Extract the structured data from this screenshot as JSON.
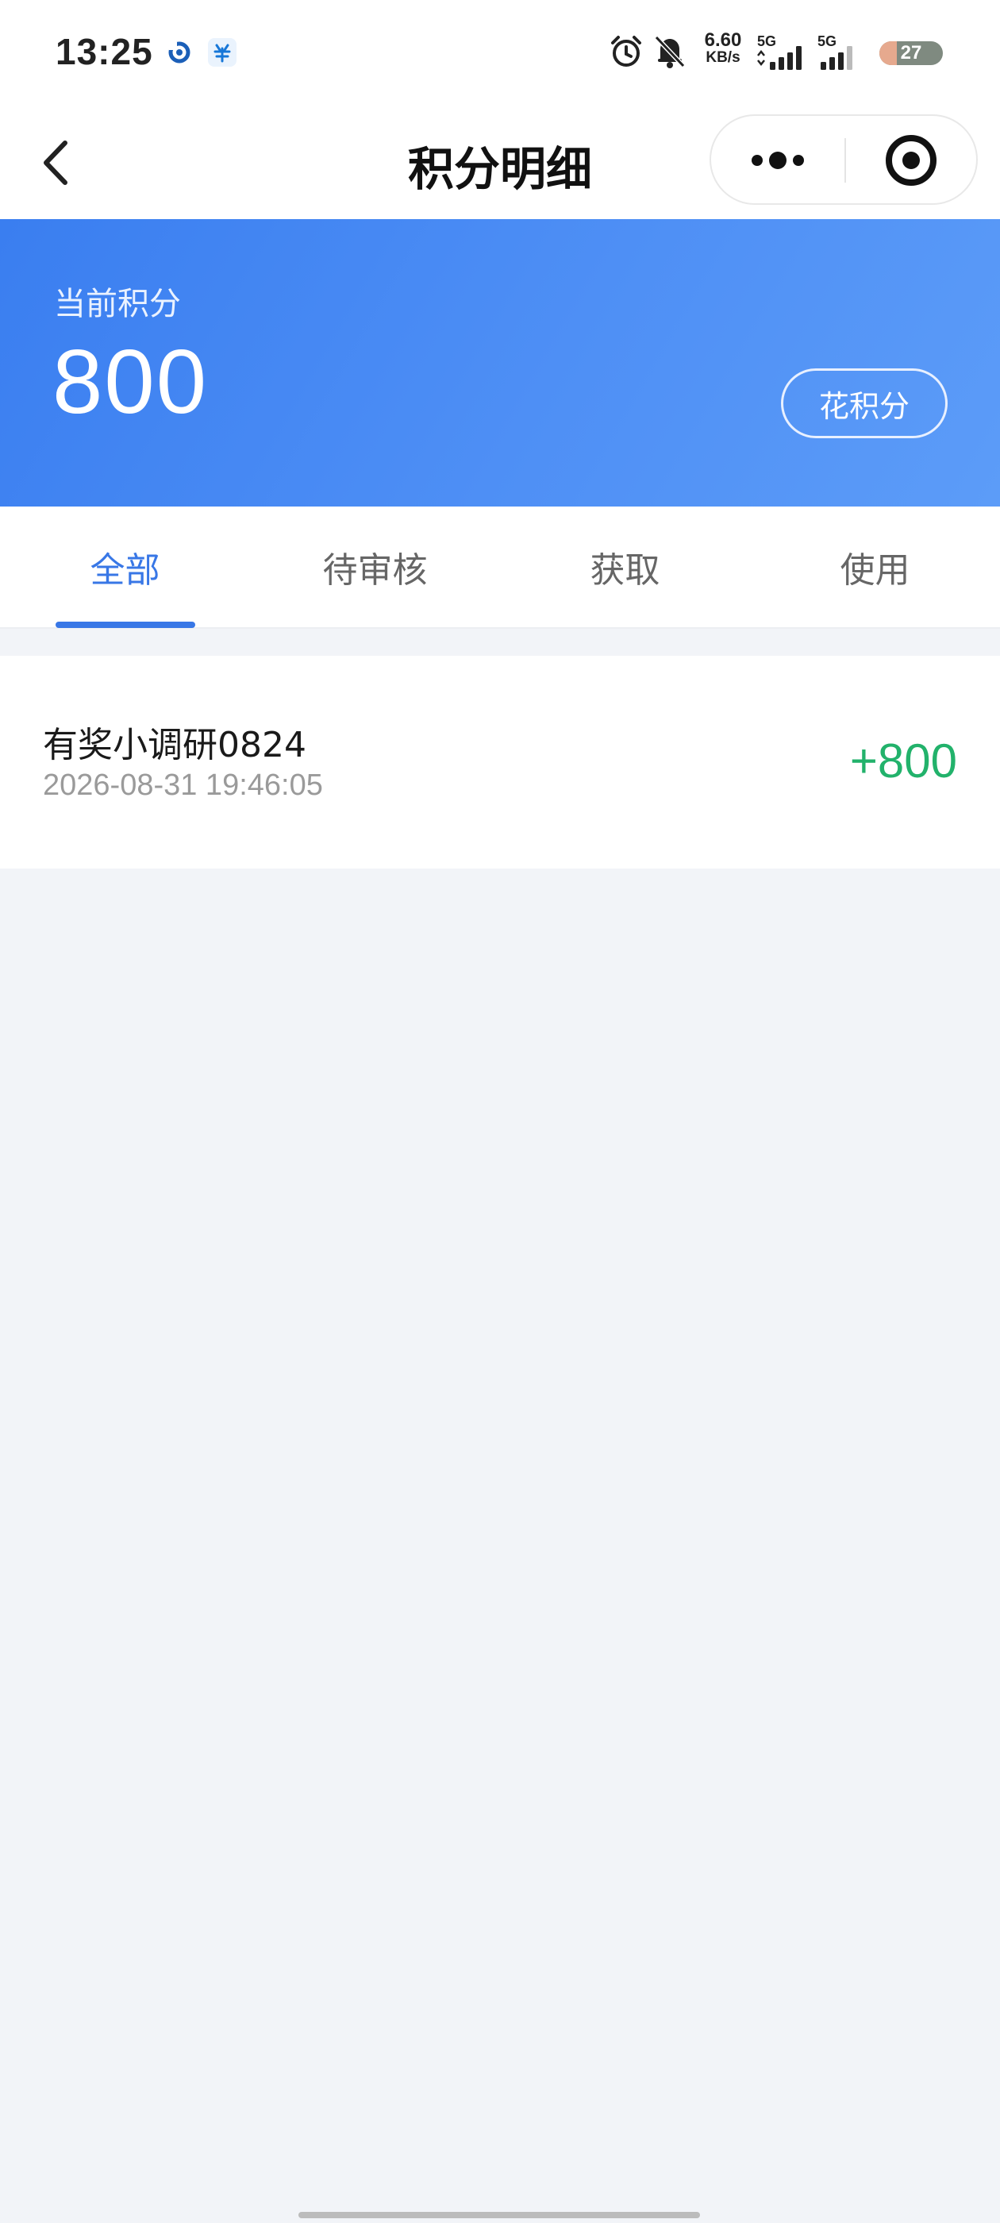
{
  "status_bar": {
    "time": "13:25",
    "net_speed_value": "6.60",
    "net_speed_unit": "KB/s",
    "sim1_label": "5G",
    "sim2_label": "5G",
    "battery_level": "27",
    "icons": [
      "alarm-icon",
      "bell-off-icon",
      "signal-icon",
      "signal-icon",
      "battery-icon"
    ]
  },
  "nav": {
    "title": "积分明细",
    "icons": [
      "back-arrow-icon",
      "more-dots-icon",
      "close-target-icon"
    ]
  },
  "points": {
    "label": "当前积分",
    "value": "800",
    "spend_button": "花积分"
  },
  "tabs": [
    {
      "label": "全部",
      "active": true
    },
    {
      "label": "待审核",
      "active": false
    },
    {
      "label": "获取",
      "active": false
    },
    {
      "label": "使用",
      "active": false
    }
  ],
  "records": [
    {
      "title": "有奖小调研0824",
      "time": "2026-08-31 19:46:05",
      "amount": "+800"
    }
  ],
  "colors": {
    "accent": "#3877e6",
    "banner_start": "#3a7ef0",
    "banner_end": "#5c9cf8",
    "positive": "#22b26b",
    "background": "#f2f4f8"
  }
}
